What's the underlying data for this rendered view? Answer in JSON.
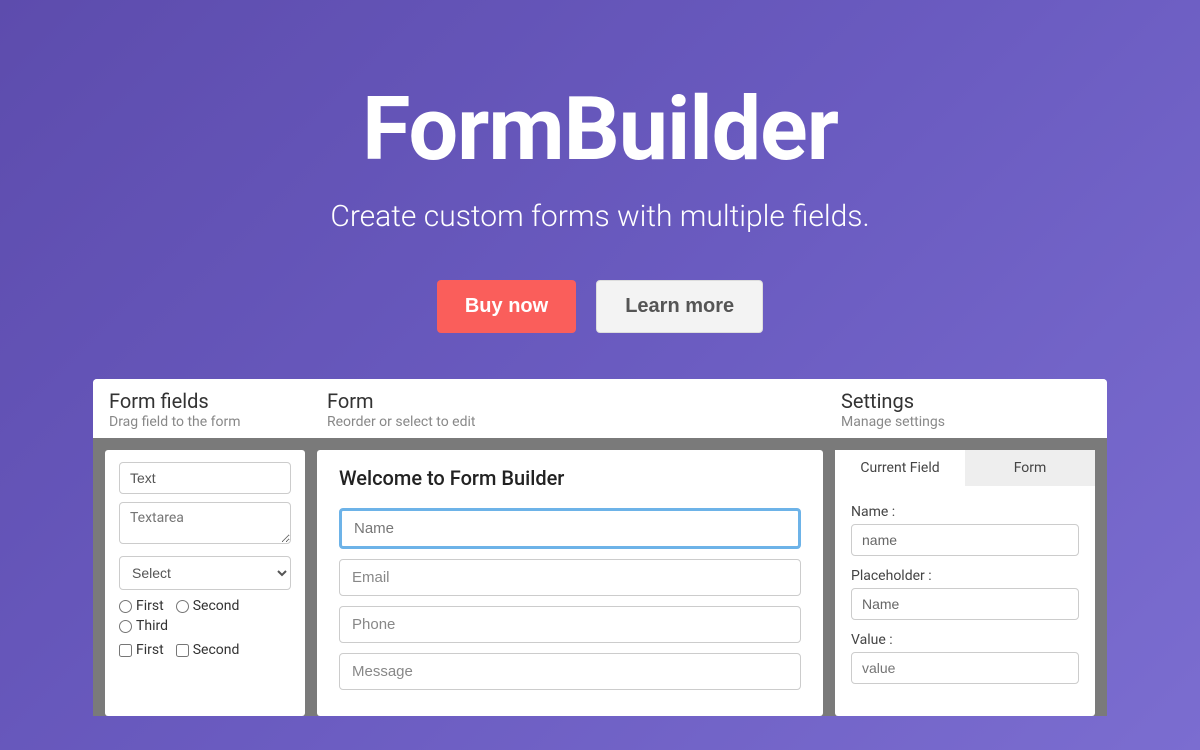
{
  "hero": {
    "title": "FormBuilder",
    "subtitle": "Create custom forms with multiple fields.",
    "buy_label": "Buy now",
    "learn_label": "Learn more"
  },
  "demo": {
    "left": {
      "title": "Form fields",
      "subtitle": "Drag field to the form",
      "text_label": "Text",
      "textarea_label": "Textarea",
      "select_label": "Select",
      "radio_options": [
        "First",
        "Second",
        "Third"
      ],
      "check_options": [
        "First",
        "Second"
      ]
    },
    "mid": {
      "title": "Form",
      "subtitle": "Reorder or select to edit",
      "form_title": "Welcome to Form Builder",
      "fields": [
        "Name",
        "Email",
        "Phone",
        "Message"
      ]
    },
    "right": {
      "title": "Settings",
      "subtitle": "Manage settings",
      "tabs": [
        "Current Field",
        "Form"
      ],
      "name_label": "Name :",
      "name_value": "name",
      "placeholder_label": "Placeholder :",
      "placeholder_value": "Name",
      "value_label": "Value :",
      "value_value": "value"
    }
  }
}
